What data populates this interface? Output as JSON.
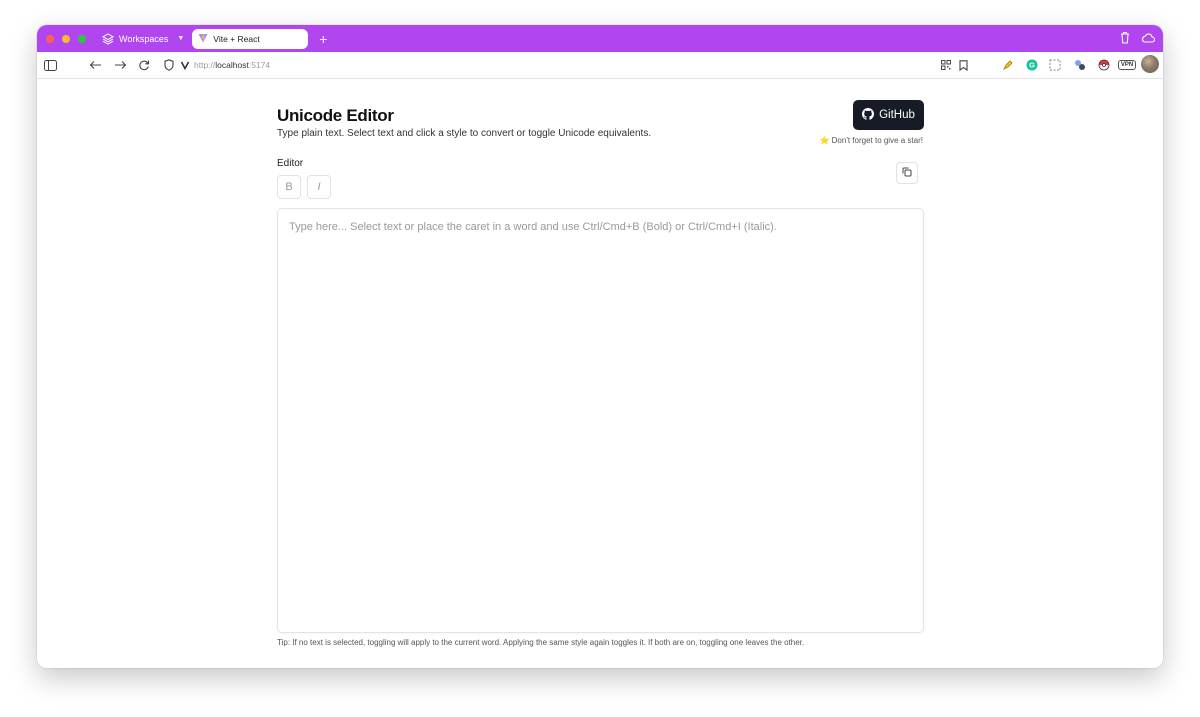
{
  "browser": {
    "accent_color": "#b146f0",
    "workspaces_label": "Workspaces",
    "tab_title": "Vite + React",
    "new_tab": "+",
    "url_scheme": "http://",
    "url_host": "localhost",
    "url_port": ":5174",
    "vpn_label": "VPN"
  },
  "page": {
    "title": "Unicode Editor",
    "subtitle": "Type plain text. Select text and click a style to convert or toggle Unicode equivalents.",
    "github_label": "GitHub",
    "star_note": "⭐ Don't forget to give a star!",
    "editor_label": "Editor",
    "bold_label": "B",
    "italic_label": "I",
    "editor_placeholder": "Type here... Select text or place the caret in a word and use Ctrl/Cmd+B (Bold) or Ctrl/Cmd+I (Italic).",
    "tip": "Tip: If no text is selected, toggling will apply to the current word. Applying the same style again toggles it. If both are on, toggling one leaves the other."
  }
}
